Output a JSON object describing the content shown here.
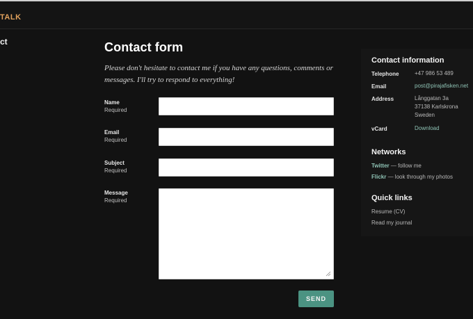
{
  "header": {
    "logo_text": "TALK",
    "nav_active": "ct"
  },
  "main": {
    "title": "Contact form",
    "intro": "Please don't hesitate to contact me if you have any questions, comments or messages. I'll try to respond to everything!",
    "fields": [
      {
        "label": "Name",
        "required": "Required",
        "value": ""
      },
      {
        "label": "Email",
        "required": "Required",
        "value": ""
      },
      {
        "label": "Subject",
        "required": "Required",
        "value": ""
      },
      {
        "label": "Message",
        "required": "Required",
        "value": ""
      }
    ],
    "send_label": "SEND"
  },
  "sidebar": {
    "contact_title": "Contact information",
    "contact": [
      {
        "key": "Telephone",
        "value": "+47 986 53 489"
      },
      {
        "key": "Email",
        "value": "post@pirajafisken.net"
      },
      {
        "key": "Address",
        "lines": [
          "Långgatan 3a",
          "37138 Karlskrona",
          "Sweden"
        ]
      },
      {
        "key": "vCard",
        "value": "Download"
      }
    ],
    "networks_title": "Networks",
    "networks": [
      {
        "name": "Twitter",
        "desc": " — follow me"
      },
      {
        "name": "Flickr",
        "desc": " — look through my photos"
      }
    ],
    "quick_title": "Quick links",
    "quick_links": [
      "Resume (CV)",
      "Read my journal"
    ]
  },
  "colors": {
    "background": "#121212",
    "accent_link": "#8fc3b5",
    "logo": "#e0a15d",
    "button": "#4b9382"
  }
}
